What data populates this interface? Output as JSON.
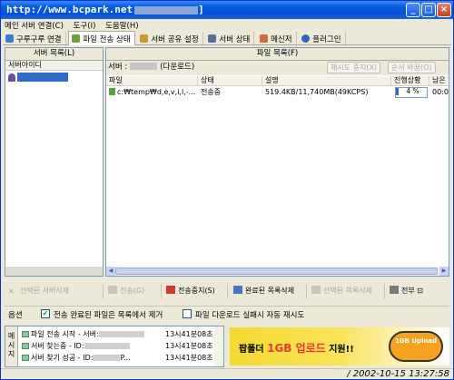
{
  "window": {
    "title": "http://www.bcpark.net",
    "title_suffix": "]",
    "controls": {
      "minimize": "_",
      "maximize": "□",
      "close": "×"
    }
  },
  "menu": [
    "메인 서버 연결(C)",
    "도구(I)",
    "도움말(H)"
  ],
  "tabs": [
    {
      "label": "구루구루 연결",
      "icon": "network-icon"
    },
    {
      "label": "파일 전송 상태",
      "icon": "transfer-icon",
      "active": true
    },
    {
      "label": "서버 공유 설정",
      "icon": "share-icon"
    },
    {
      "label": "서버 상태",
      "icon": "monitor-icon"
    },
    {
      "label": "메신저",
      "icon": "messenger-icon"
    },
    {
      "label": "플러그인",
      "icon": "plugin-icon"
    }
  ],
  "left_panel": {
    "title": "서버 목록(L)",
    "column": "서버아이디",
    "items": [
      ""
    ]
  },
  "right_panel": {
    "title": "파일 목록(F)",
    "server_prefix": "서버 :",
    "server_suffix": "(다운로드)",
    "btn_retry": "재시도 중지(X)",
    "btn_order": "순서 바꿈(O)",
    "columns": [
      "파일",
      "상태",
      "설명",
      "진행상황",
      "남은"
    ],
    "rows": [
      {
        "file": "c:₩temp₩d,e,v,i,l,-...",
        "status": "전송중",
        "desc": "519.4KB/11,740MB(49KCPS)",
        "progress": 4,
        "progress_label": "4 %",
        "remaining": "00:0"
      }
    ]
  },
  "actions": {
    "delete_server": "선택된 서버삭제",
    "transfer": "전송(G)",
    "stop": "전송중지(S)",
    "completed_list": "완료된 목록삭제",
    "delete_selected": "선택된 목록삭제",
    "send_all": "전부 ⊡"
  },
  "options": {
    "label": "옵션",
    "opt1": "전송 완료된 파일은 목록에서 제거",
    "opt1_checked": "✔",
    "opt2": "파일 다운로드 실패시 자동 재시도"
  },
  "messages": {
    "side_label": "메시지",
    "rows": [
      {
        "text": "파일 전송 시작 - 서버:",
        "time": "13시41분08초"
      },
      {
        "text": "서버 찾는중 - ID:",
        "time": "13시41분08초"
      },
      {
        "text": "서버 찾기 성공 - ID:",
        "time": "13시41분08초"
      }
    ],
    "row3_suffix": "P..."
  },
  "banner": {
    "prefix": "팝폴더",
    "highlight": "1GB 업로드",
    "suffix": "지원!!",
    "badge": "1GB Upload"
  },
  "status": {
    "datetime": "/ 2002-10-15 13:27:58"
  }
}
